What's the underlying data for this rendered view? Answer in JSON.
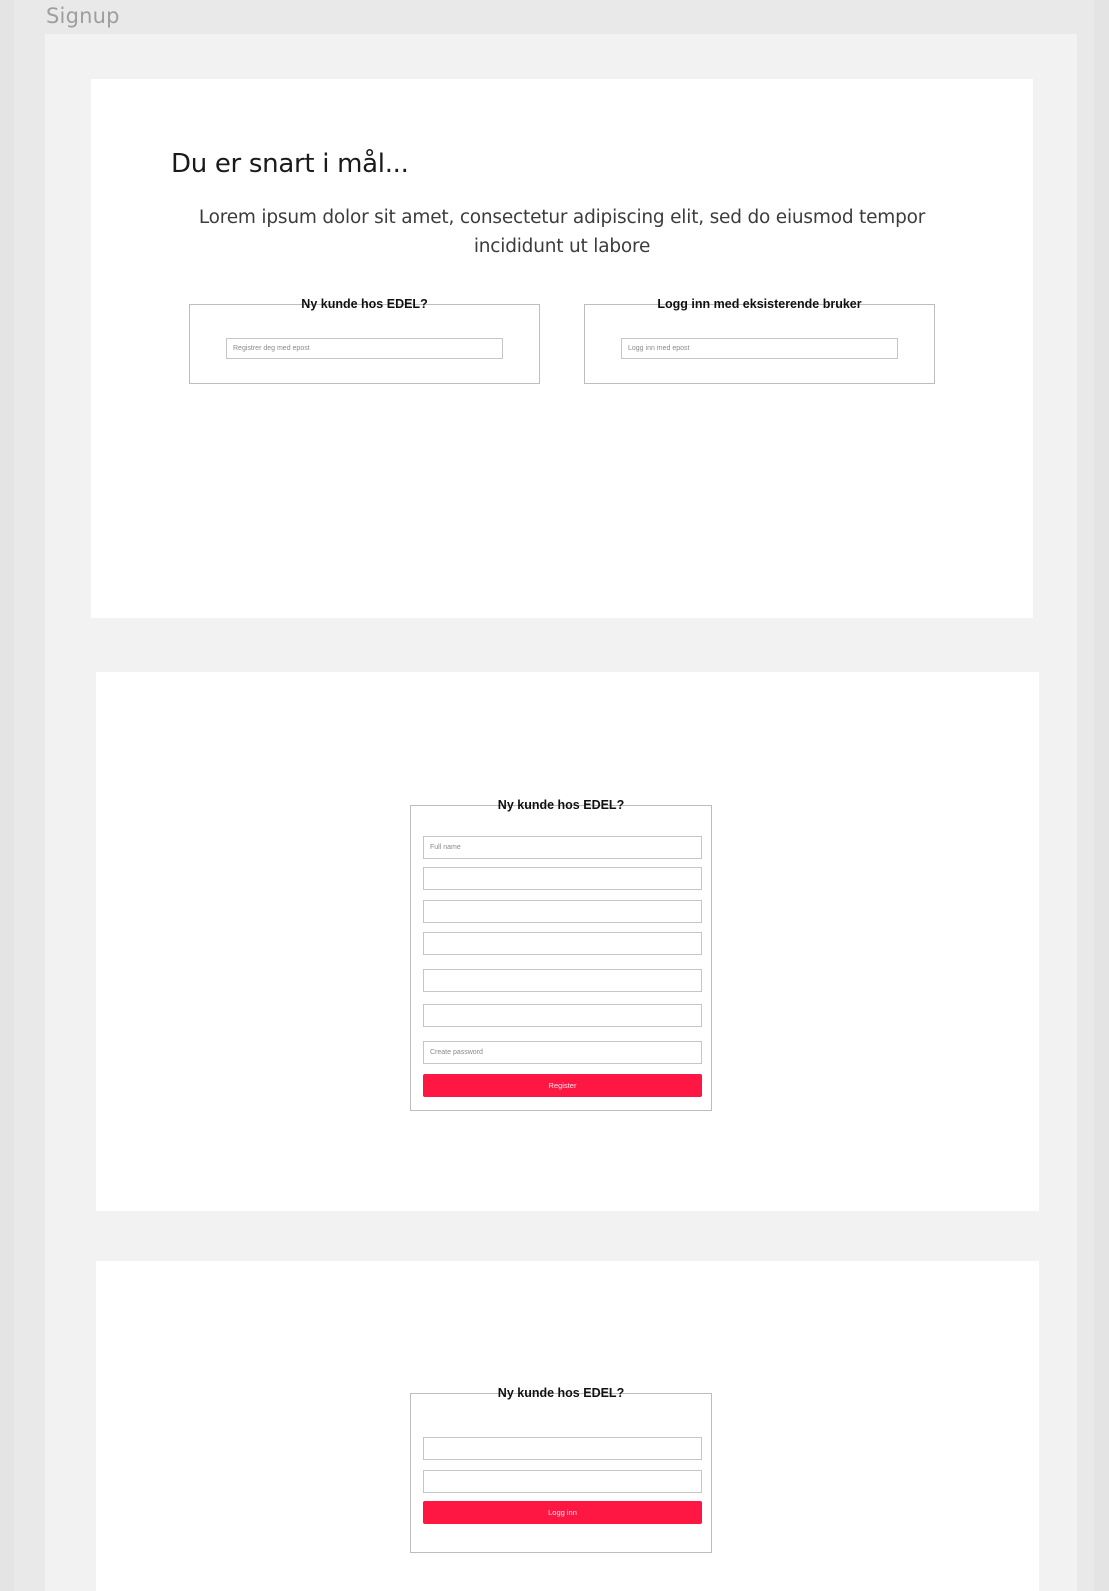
{
  "canvas": {
    "label": "Signup"
  },
  "frame1": {
    "heading": "Du er snart i mål...",
    "lead": "Lorem ipsum dolor sit amet, consectetur adipiscing elit, sed do eiusmod tempor incididunt ut labore",
    "new_customer": {
      "title": "Ny kunde hos EDEL?",
      "email_placeholder": "Registrer deg med epost"
    },
    "existing_user": {
      "title": "Logg inn med eksisterende bruker",
      "email_placeholder": "Logg inn med epost"
    }
  },
  "frame2": {
    "title": "Ny kunde hos EDEL?",
    "fields": [
      "Full name",
      "",
      "",
      "",
      "",
      "",
      "Create password"
    ],
    "button_label": "Register"
  },
  "frame3": {
    "title": "Ny kunde hos EDEL?",
    "fields": [
      "",
      ""
    ],
    "button_label": "Logg inn"
  },
  "colors": {
    "accent": "#ff1744",
    "canvas_bg": "#e4e4e4",
    "artboard_bg": "#f2f2f2",
    "frame_bg": "#ffffff",
    "border": "#bdbdbd"
  }
}
